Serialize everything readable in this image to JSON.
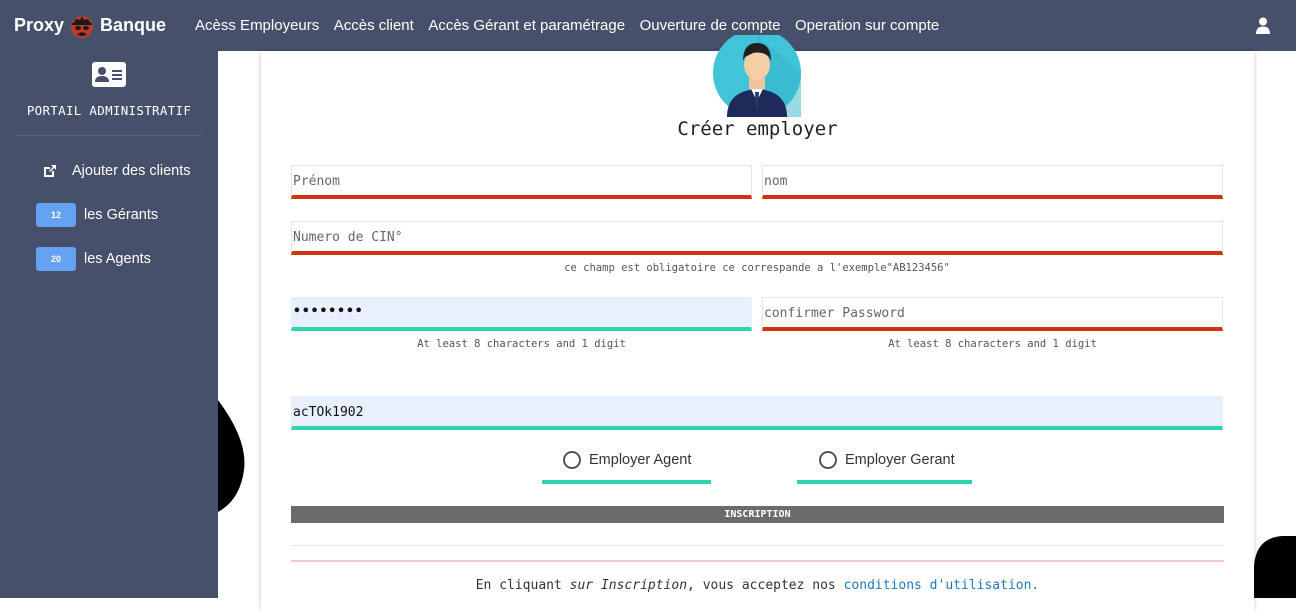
{
  "navbar": {
    "brand_left": "Proxy",
    "brand_right": "Banque",
    "links": [
      "Acèss Employeurs",
      "Accès client",
      "Accès Gérant et paramétrage",
      "Ouverture de compte",
      "Operation sur compte"
    ]
  },
  "sidebar": {
    "title": "PORTAIL ADMINISTRATIF",
    "add_clients": "Ajouter des clients",
    "items": [
      {
        "badge": "12",
        "label": "les Gérants"
      },
      {
        "badge": "20",
        "label": "les Agents"
      }
    ]
  },
  "form": {
    "title": "Créer employer",
    "prenom_placeholder": "Prénom",
    "nom_placeholder": "nom",
    "cin_placeholder": "Numero de CIN°",
    "cin_hint": "ce champ est obligatoire ce correspande a l'exemple\"AB123456\"",
    "password_value": "••••••••",
    "password_hint": "At least 8 characters and 1 digit",
    "confirm_placeholder": "confirmer Password",
    "confirm_hint": "At least 8 characters and 1 digit",
    "code_value": "acTOk1902",
    "radio_agent": "Employer Agent",
    "radio_gerant": "Employer Gerant",
    "submit_label": "INSCRIPTION",
    "terms_prefix": "En cliquant ",
    "terms_em": "sur Inscription",
    "terms_mid": ", vous acceptez nos ",
    "terms_link": "conditions d'utilisation."
  },
  "colors": {
    "nav_bg": "#46506a",
    "badge": "#66a2f2",
    "error_line": "#d13212",
    "ok_line": "#2ed4b0",
    "link": "#1e78c8"
  },
  "icons": {
    "brand": "spy-logo-icon",
    "user": "user-icon",
    "card": "id-card-icon",
    "add": "external-link-icon"
  }
}
